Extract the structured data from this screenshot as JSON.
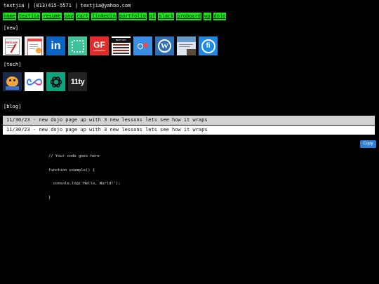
{
  "header": {
    "name": "textjia",
    "sep1": "|",
    "phone": "(813)415-5571",
    "sep2": "|",
    "email": "textjia@yahoo.com"
  },
  "nav": {
    "items": [
      "home",
      "textjia",
      "resume",
      "pay",
      "cart",
      "linkedin",
      "portfolio",
      "gf",
      "slack",
      "proboard",
      "wp",
      "dojo"
    ]
  },
  "sections": {
    "new_label": "[new]",
    "tech_label": "[tech]",
    "blog_label": "[blog]"
  },
  "new_tiles": {
    "resume_text": "RESUME",
    "linkedin_text": "in",
    "gf_text": "GF",
    "gf_sub": "COOKBOOK",
    "book_top": "BEST WAY",
    "wp_text": "W",
    "fi_text": "fi"
  },
  "tech_tiles": {
    "eleventy_text": "11ty"
  },
  "blog": {
    "rows": [
      "11/30/23 - new dojo page up with 3 new lessons lets see how it wraps",
      "11/30/23 - new dojo page up with 3 new lessons lets see how it wraps"
    ]
  },
  "code_block": {
    "copy_label": "Copy",
    "lines": [
      "// Your code goes here",
      "function example() {",
      "  console.log('Hello, World!');",
      "}"
    ]
  },
  "colors": {
    "nav_bg": "#19e619",
    "blog_row_1": "#d2d2d2",
    "blog_row_2": "#ffffff",
    "copy_button": "#2f7fd6"
  }
}
